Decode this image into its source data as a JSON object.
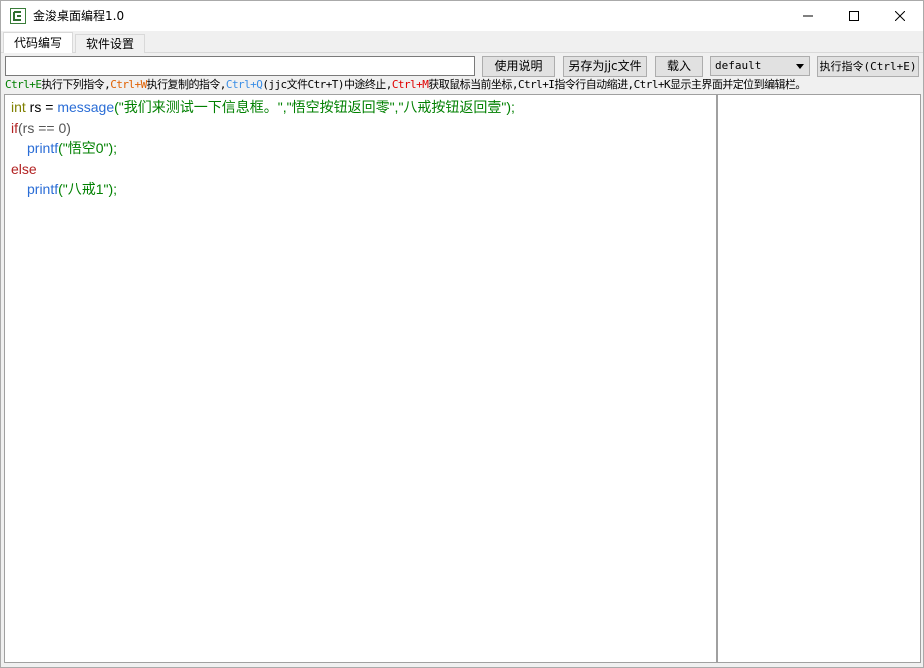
{
  "window": {
    "title": "金浚桌面编程1.0"
  },
  "tabs": [
    {
      "label": "代码编写",
      "active": true
    },
    {
      "label": "软件设置",
      "active": false
    }
  ],
  "toolbar": {
    "command_input_value": "",
    "help_button": "使用说明",
    "save_as_button": "另存为jjc文件",
    "load_button": "载入",
    "profile_select_value": "default",
    "execute_button": "执行指令(Ctrl+E)"
  },
  "hint": {
    "k1": "Ctrl+E",
    "t1": "执行下列指令,",
    "k2": "Ctrl+W",
    "t2": "执行复制的指令,",
    "k3": "Ctrl+Q",
    "t3": "(jjc文件Ctr+T)中途终止,",
    "k4": "Ctrl+M",
    "t4": "获取鼠标当前坐标,Ctrl+I指令行自动缩进,Ctrl+K显示主界面并定位到编辑栏。"
  },
  "code": {
    "l1_type": "int",
    "l1_var": " rs = ",
    "l1_func": "message",
    "l1_args": "(\"我们来测试一下信息框。\",\"悟空按钮返回零\",\"八戒按钮返回壹\");",
    "l2_kw": "if",
    "l2_cond": "(rs == 0)",
    "l3_func": "printf",
    "l3_args": "(\"悟空0\");",
    "l4_kw": "else",
    "l5_func": "printf",
    "l5_args": "(\"八戒1\");"
  },
  "colors": {
    "accent_green": "#008000",
    "accent_orange": "#e06000",
    "accent_blue": "#3a8ee6",
    "accent_red": "#e00000"
  }
}
